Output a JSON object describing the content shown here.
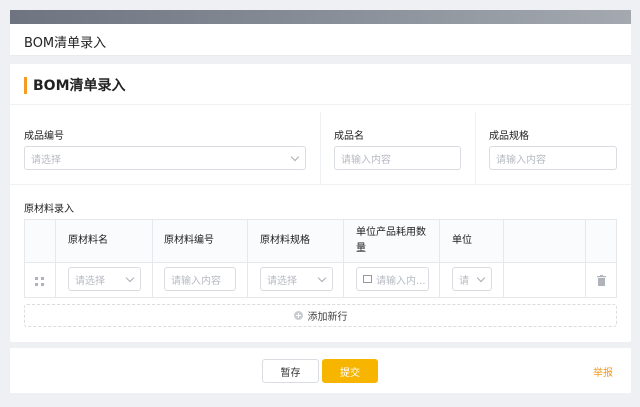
{
  "header": {
    "title": "BOM清单录入"
  },
  "form": {
    "section_title": "BOM清单录入",
    "product_code": {
      "label": "成品编号",
      "placeholder": "请选择"
    },
    "product_name": {
      "label": "成品名",
      "placeholder": "请输入内容"
    },
    "product_spec": {
      "label": "成品规格",
      "placeholder": "请输入内容"
    }
  },
  "materials": {
    "label": "原材料录入",
    "columns": [
      "原材料名",
      "原材料编号",
      "原材料规格",
      "单位产品耗用数",
      "量",
      "单位"
    ],
    "row": {
      "name_placeholder": "请选择",
      "code_placeholder": "请输入内容",
      "spec_placeholder": "请选择",
      "usage_placeholder": "请输入内...",
      "unit_placeholder": "请"
    },
    "add_row_label": "添加新行"
  },
  "footer": {
    "save_label": "暂存",
    "submit_label": "提交",
    "report_label": "举报"
  },
  "colors": {
    "accent": "#f59a23",
    "primary_button": "#f7b500"
  },
  "icons": [
    "drag-handle-icon",
    "trash-icon",
    "plus-circle-icon",
    "image-icon",
    "chevron-down-icon"
  ]
}
